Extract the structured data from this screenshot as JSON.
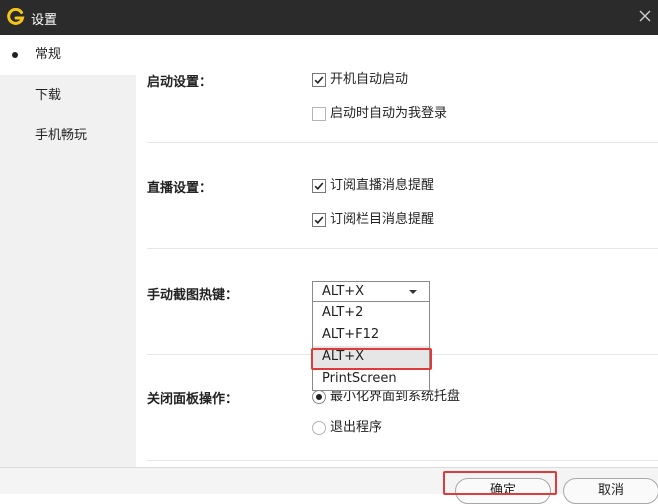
{
  "window": {
    "title": "设置"
  },
  "sidebar": {
    "items": [
      {
        "label": "常规",
        "active": true
      },
      {
        "label": "下载"
      },
      {
        "label": "手机畅玩"
      }
    ]
  },
  "sections": {
    "startup": {
      "label": "启动设置：",
      "options": [
        {
          "label": "开机自动启动",
          "checked": true
        },
        {
          "label": "启动时自动为我登录",
          "checked": false
        }
      ]
    },
    "live": {
      "label": "直播设置：",
      "options": [
        {
          "label": "订阅直播消息提醒",
          "checked": true
        },
        {
          "label": "订阅栏目消息提醒",
          "checked": true
        }
      ]
    },
    "hotkey": {
      "label": "手动截图热键：",
      "selected": "ALT+X",
      "options": [
        "ALT+2",
        "ALT+F12",
        "ALT+X",
        "PrintScreen"
      ]
    },
    "close": {
      "label": "关闭面板操作：",
      "options": [
        {
          "label": "最小化界面到系统托盘",
          "selected": true
        },
        {
          "label": "退出程序",
          "selected": false
        }
      ]
    }
  },
  "footer": {
    "confirm_label": "确定",
    "cancel_label": "取消"
  },
  "colors": {
    "titlebar": "#2b2b2b",
    "logo": "#f5c518",
    "highlight": "#e03b3b"
  }
}
